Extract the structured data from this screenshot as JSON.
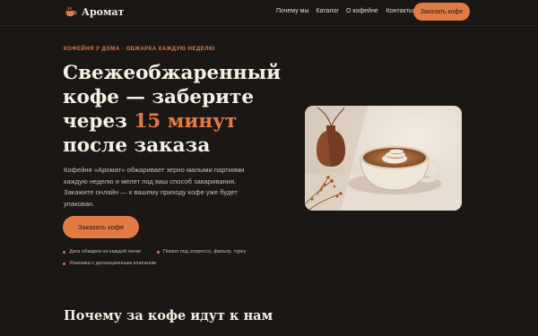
{
  "brand": {
    "name": "Аромат"
  },
  "nav": {
    "links": [
      "Почему мы",
      "Каталог",
      "О кофейне",
      "Контакты"
    ],
    "cta": "Заказать кофе"
  },
  "hero": {
    "eyebrow": "КОФЕЙНЯ У ДОМА · ОБЖАРКА КАЖДУЮ НЕДЕЛЮ",
    "title_part1": "Свежеобжаренный кофе — заберите через ",
    "title_accent": "15 минут",
    "title_part2": " после заказа",
    "lead": "Кофейня «Аромат» обжаривает зерно малыми партиями каждую неделю и мелет под ваш способ заваривания. Закажите онлайн — к вашему приходу кофе уже будет упакован.",
    "cta": "Заказать кофе",
    "features": [
      "Дата обжарки на каждой пачке",
      "Помол под эспрессо, фильтр, турку",
      "Упаковка с дегазационным клапаном"
    ]
  },
  "sections": {
    "why_title": "Почему за кофе идут к нам"
  },
  "colors": {
    "accent": "#e27a45",
    "background": "#1b1714"
  }
}
